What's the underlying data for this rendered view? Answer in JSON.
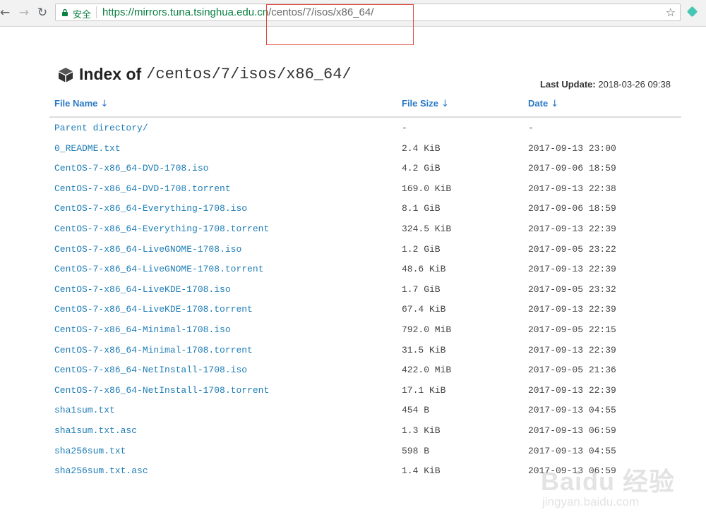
{
  "browser": {
    "secure_label": "安全",
    "url_host": "https://mirrors.tuna.tsinghua.edu.cn",
    "url_path": "/centos/7/isos/x86_64/"
  },
  "header": {
    "index_label": "Index of",
    "path": "/centos/7/isos/x86_64/",
    "last_update_label": "Last Update:",
    "last_update_value": "2018-03-26 09:38"
  },
  "table": {
    "columns": [
      "File Name",
      "File Size",
      "Date"
    ],
    "sort_arrow": "↓",
    "rows": [
      {
        "name": "Parent directory/",
        "size": "-",
        "date": "-"
      },
      {
        "name": "0_README.txt",
        "size": "2.4 KiB",
        "date": "2017-09-13 23:00"
      },
      {
        "name": "CentOS-7-x86_64-DVD-1708.iso",
        "size": "4.2 GiB",
        "date": "2017-09-06 18:59"
      },
      {
        "name": "CentOS-7-x86_64-DVD-1708.torrent",
        "size": "169.0 KiB",
        "date": "2017-09-13 22:38"
      },
      {
        "name": "CentOS-7-x86_64-Everything-1708.iso",
        "size": "8.1 GiB",
        "date": "2017-09-06 18:59"
      },
      {
        "name": "CentOS-7-x86_64-Everything-1708.torrent",
        "size": "324.5 KiB",
        "date": "2017-09-13 22:39"
      },
      {
        "name": "CentOS-7-x86_64-LiveGNOME-1708.iso",
        "size": "1.2 GiB",
        "date": "2017-09-05 23:22"
      },
      {
        "name": "CentOS-7-x86_64-LiveGNOME-1708.torrent",
        "size": "48.6 KiB",
        "date": "2017-09-13 22:39"
      },
      {
        "name": "CentOS-7-x86_64-LiveKDE-1708.iso",
        "size": "1.7 GiB",
        "date": "2017-09-05 23:32"
      },
      {
        "name": "CentOS-7-x86_64-LiveKDE-1708.torrent",
        "size": "67.4 KiB",
        "date": "2017-09-13 22:39"
      },
      {
        "name": "CentOS-7-x86_64-Minimal-1708.iso",
        "size": "792.0 MiB",
        "date": "2017-09-05 22:15"
      },
      {
        "name": "CentOS-7-x86_64-Minimal-1708.torrent",
        "size": "31.5 KiB",
        "date": "2017-09-13 22:39"
      },
      {
        "name": "CentOS-7-x86_64-NetInstall-1708.iso",
        "size": "422.0 MiB",
        "date": "2017-09-05 21:36"
      },
      {
        "name": "CentOS-7-x86_64-NetInstall-1708.torrent",
        "size": "17.1 KiB",
        "date": "2017-09-13 22:39"
      },
      {
        "name": "sha1sum.txt",
        "size": "454 B",
        "date": "2017-09-13 04:55"
      },
      {
        "name": "sha1sum.txt.asc",
        "size": "1.3 KiB",
        "date": "2017-09-13 06:59"
      },
      {
        "name": "sha256sum.txt",
        "size": "598 B",
        "date": "2017-09-13 04:55"
      },
      {
        "name": "sha256sum.txt.asc",
        "size": "1.4 KiB",
        "date": "2017-09-13 06:59"
      }
    ]
  },
  "watermark": {
    "main": "Baidu 经验",
    "sub": "jingyan.baidu.com"
  },
  "colors": {
    "link": "#1f7db6",
    "header_link": "#2a7ac4",
    "secure": "#0b8043",
    "highlight": "#e0473b"
  },
  "icons": {
    "back": "back-arrow-icon",
    "forward": "forward-arrow-icon",
    "reload": "reload-icon",
    "lock": "lock-icon",
    "bookmark": "star-icon",
    "extension": "extension-icon",
    "title": "cube-icon"
  }
}
